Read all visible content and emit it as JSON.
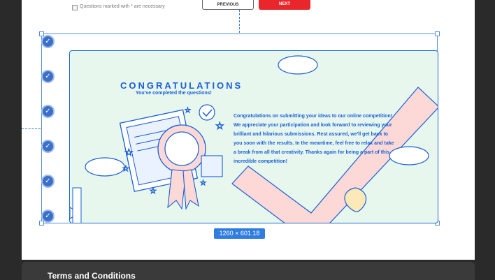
{
  "form": {
    "required_note": "Questions marked with * are necessary",
    "prev_label": "PREVIOUS",
    "next_label": "NEXT"
  },
  "illustration": {
    "title": "CONGRATULATIONS",
    "subtitle": "You've completed the questions!",
    "body": "Congratulations on submitting your ideas to our online competition! We appreciate your participation and look forward to reviewing your brilliant and hilarious submissions. Rest assured, we'll get back to you soon with the results. In the meantime, feel free to relax and take a break from all that creativity. Thanks again for being a part of this incredible competition!"
  },
  "selection": {
    "dimensions": "1260 × 601.18"
  },
  "rail_icons": [
    "check-icon",
    "check-icon",
    "check-icon",
    "check-icon",
    "check-icon",
    "check-icon"
  ],
  "terms": {
    "title": "Terms and Conditions"
  },
  "colors": {
    "accent": "#1a5fd6",
    "next_button": "#e8262b",
    "background": "#e8f7ee",
    "selection": "#2f7de0"
  }
}
